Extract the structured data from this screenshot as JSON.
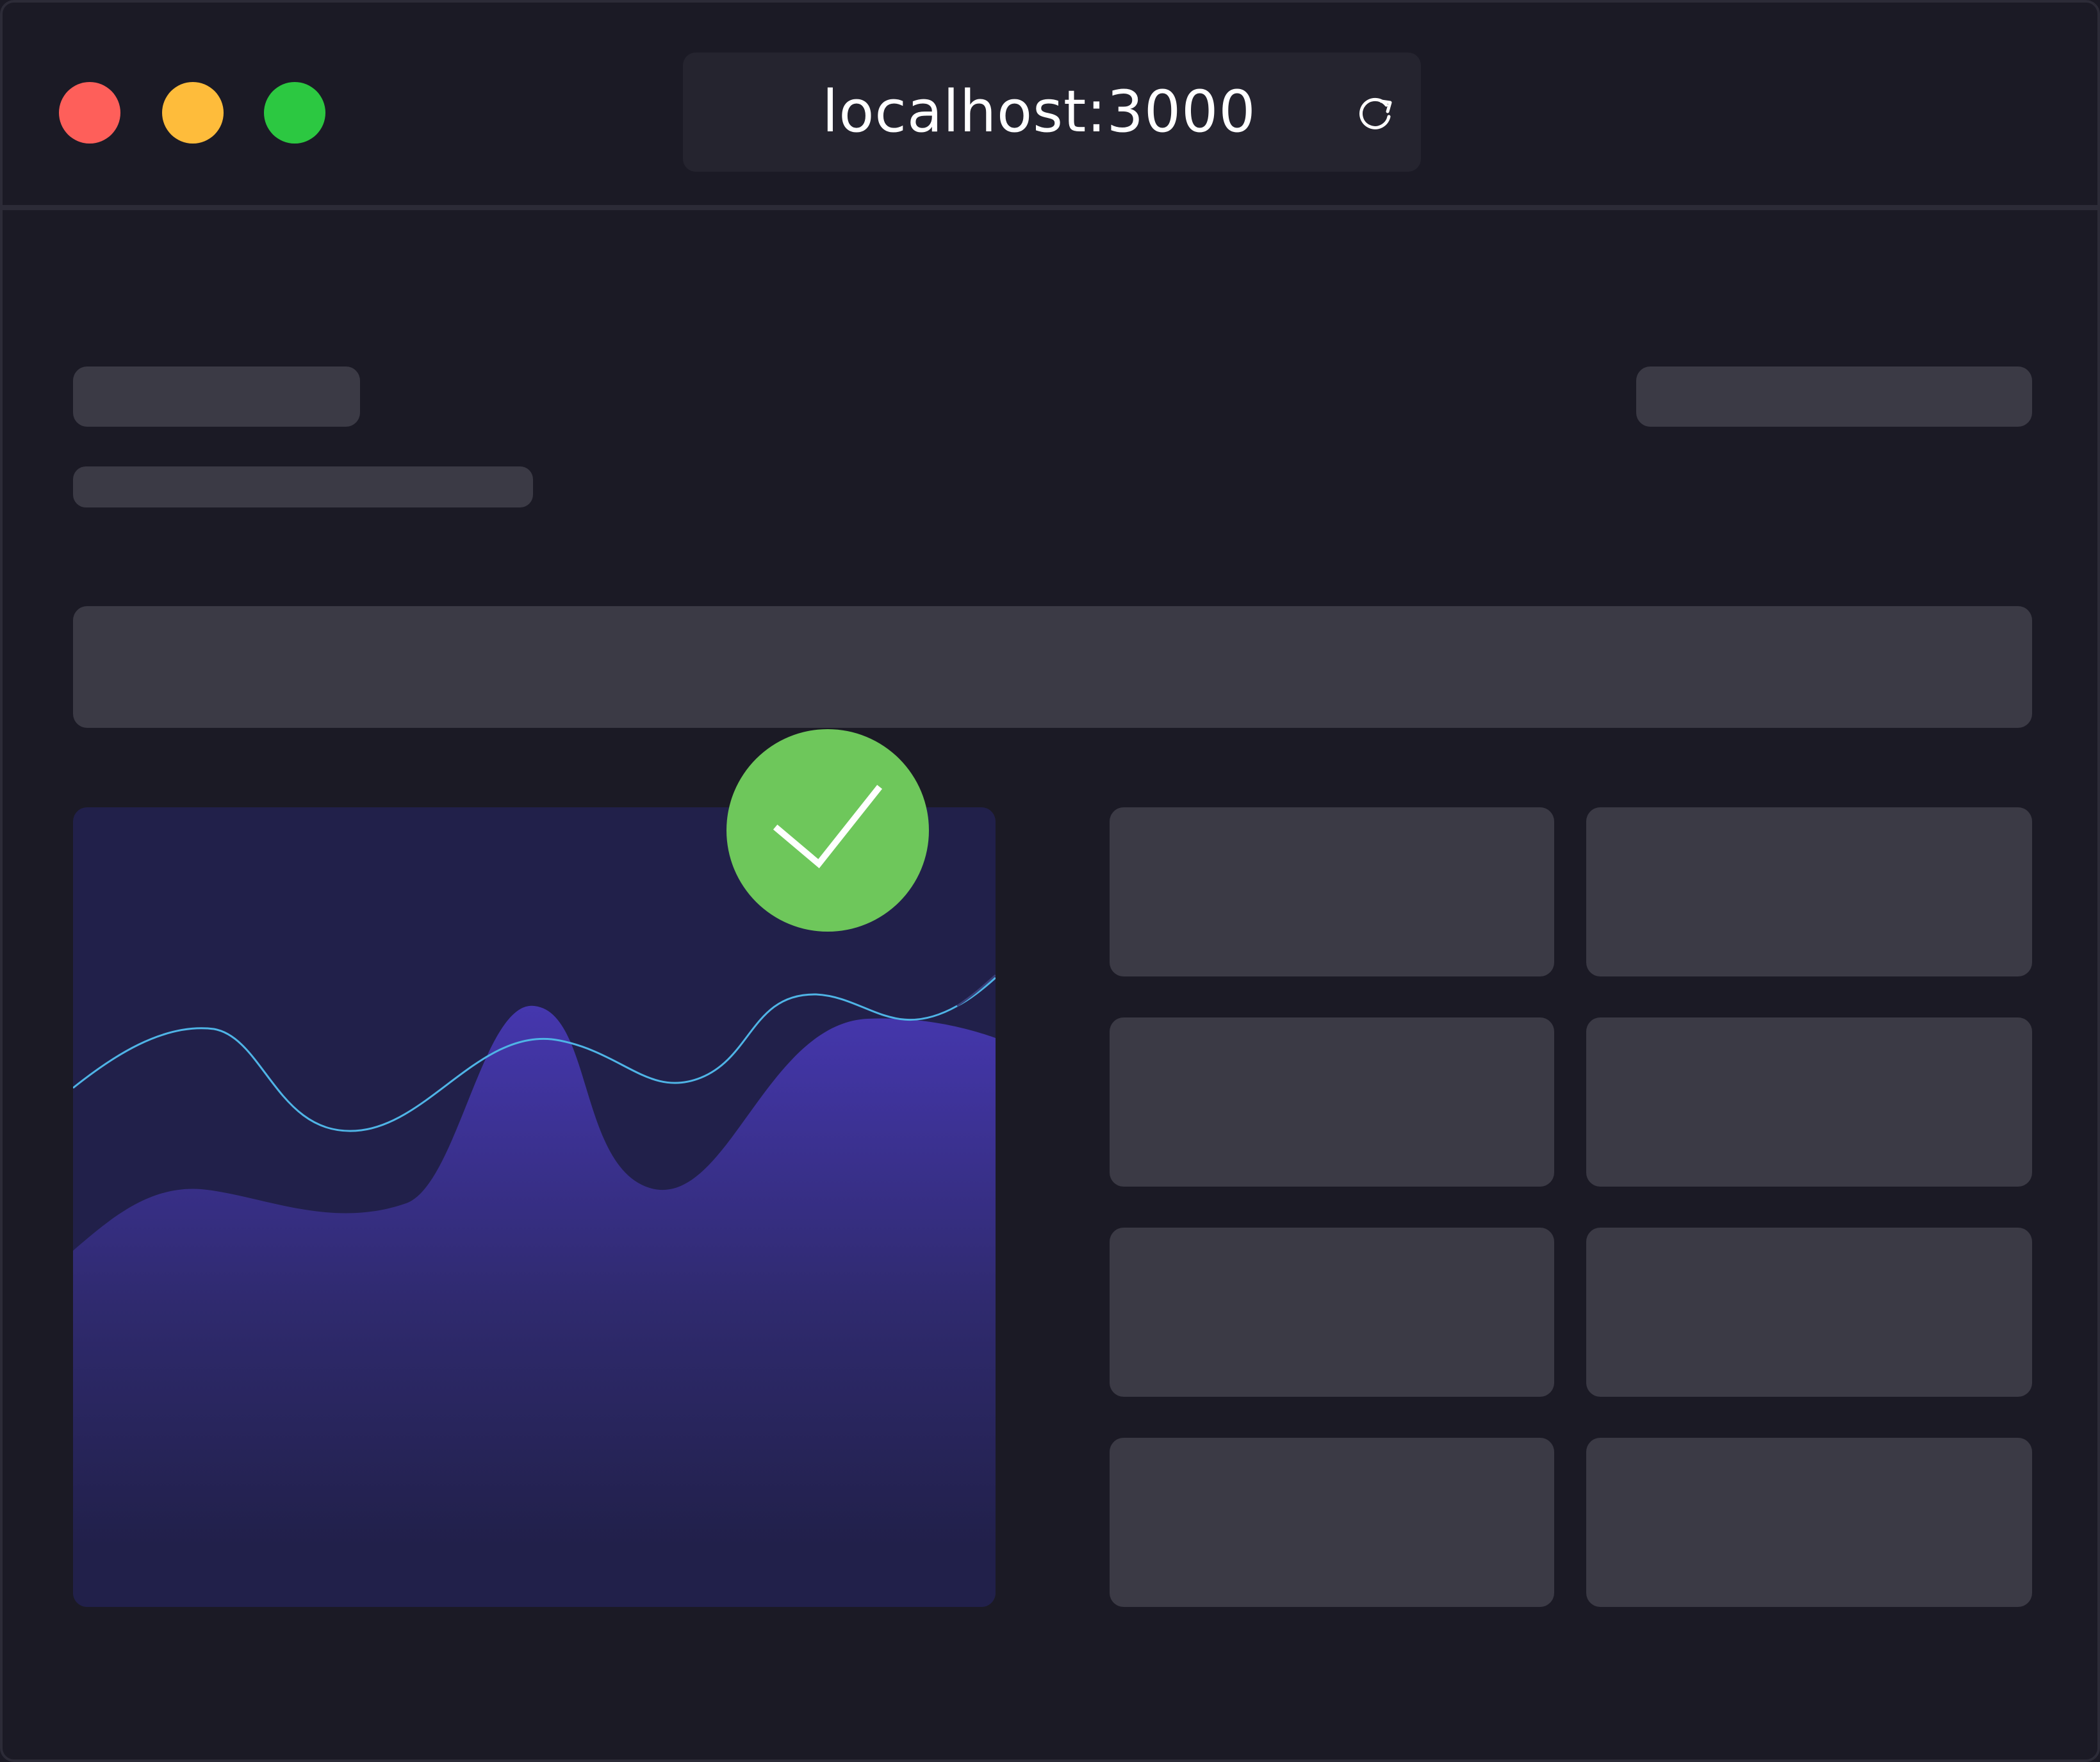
{
  "browser": {
    "url": "localhost:3000",
    "traffic_lights": {
      "close_color": "#fe5f5a",
      "minimize_color": "#febc3b",
      "maximize_color": "#2cc841"
    },
    "reload_icon": "reload-icon"
  },
  "colors": {
    "window_bg": "#1b1a25",
    "skeleton": "#3b3a45",
    "chart_panel": "#21204a",
    "area_fill_top": "#4537ae",
    "line_stroke": "#4fb4e6",
    "success": "#6ec75b"
  },
  "status_icon": "check-icon"
}
